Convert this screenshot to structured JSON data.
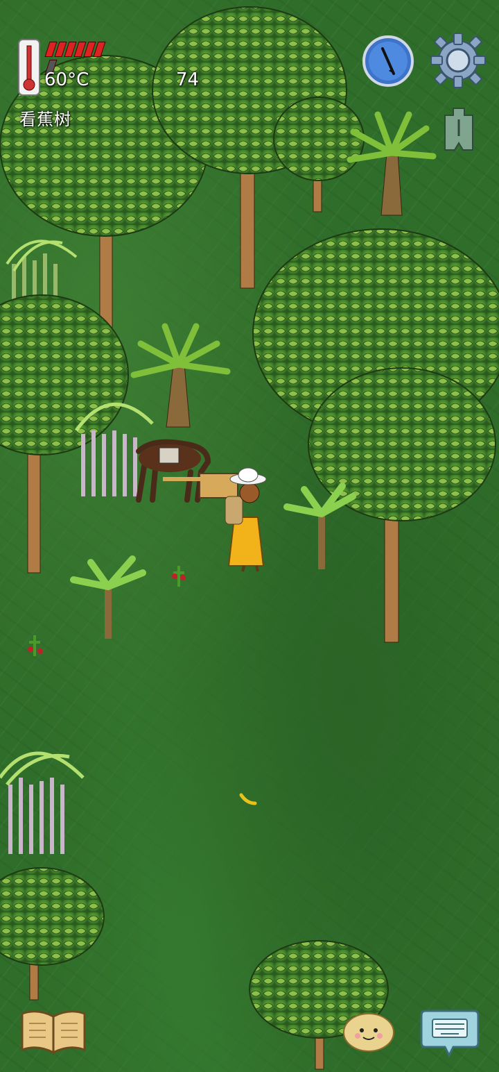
{
  "hud": {
    "temperature": "60°C",
    "age": "74",
    "hover_label": "看蕉树",
    "food_pips_total": 7,
    "food_pips_filled": 6
  },
  "icons": {
    "thermometer": "thermometer-icon",
    "compass": "compass-icon",
    "settings": "gear-icon",
    "tech_tree": "spade-coin-icon",
    "recipe_book": "book-icon",
    "emote": "emote-face-icon",
    "keyboard": "keyboard-icon"
  },
  "colors": {
    "ground": "#2f6d2a",
    "food_full": "#dd2222",
    "food_empty": "#555555",
    "dress": "#f2b21a"
  }
}
